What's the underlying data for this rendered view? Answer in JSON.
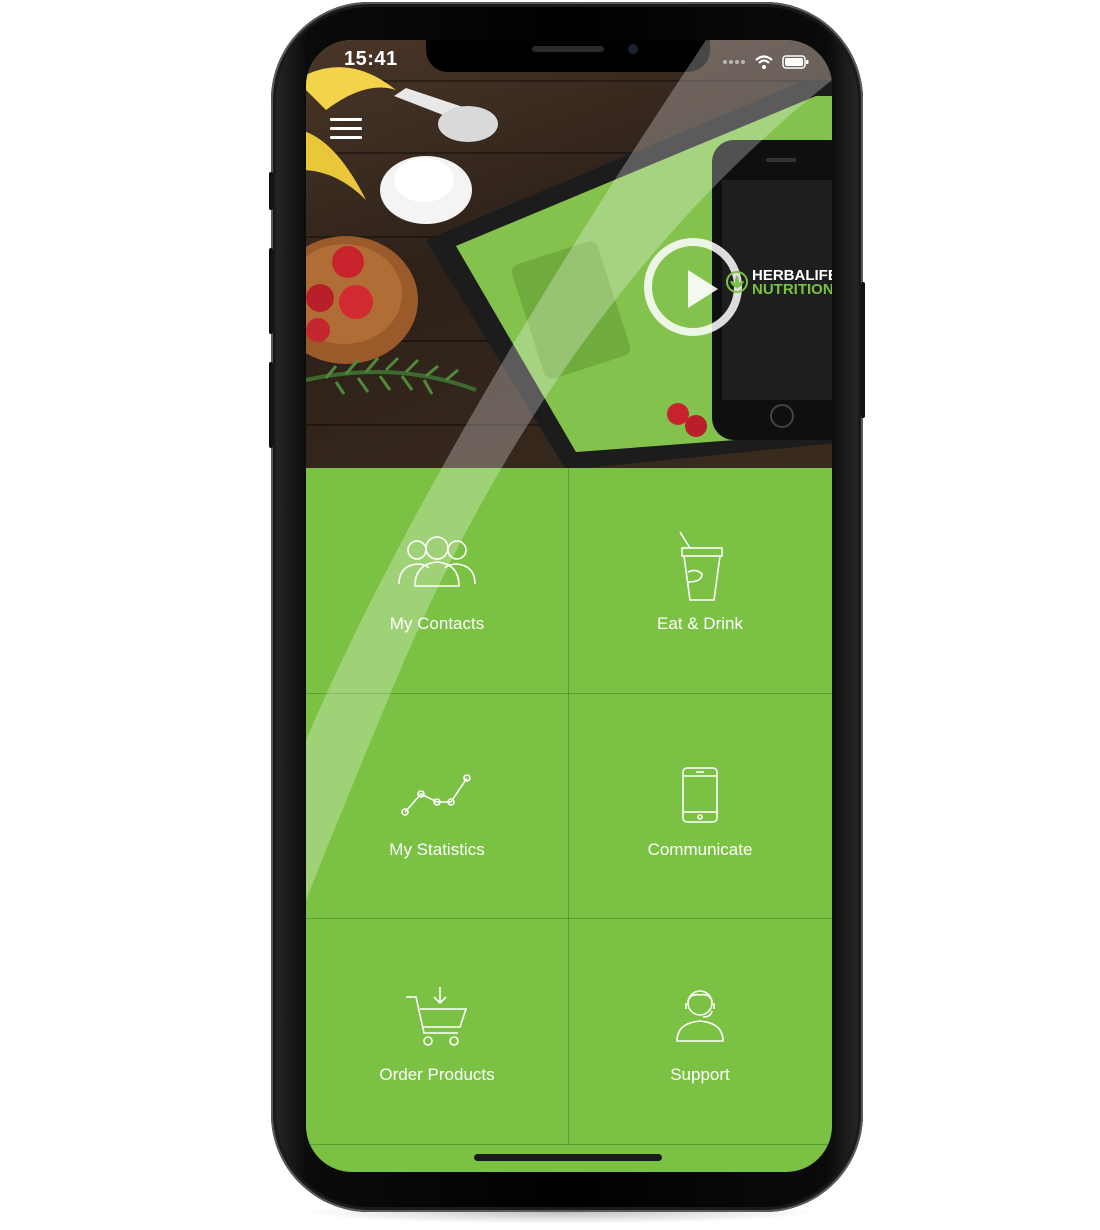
{
  "status_bar": {
    "time": "15:41"
  },
  "hero": {
    "logo_line1": "HERBALIFE",
    "logo_line2": "NUTRITION",
    "tablet_brand": "HERBALIFE"
  },
  "menu": {
    "items": [
      {
        "label": "My Contacts",
        "icon": "contacts-icon"
      },
      {
        "label": "Eat & Drink",
        "icon": "cup-icon"
      },
      {
        "label": "My Statistics",
        "icon": "statistics-icon"
      },
      {
        "label": "Communicate",
        "icon": "phone-icon"
      },
      {
        "label": "Order Products",
        "icon": "cart-icon"
      },
      {
        "label": "Support",
        "icon": "support-agent-icon"
      }
    ]
  },
  "colors": {
    "brand_green": "#7bc143",
    "divider": "#5c9a33",
    "device_body": "#000000"
  }
}
